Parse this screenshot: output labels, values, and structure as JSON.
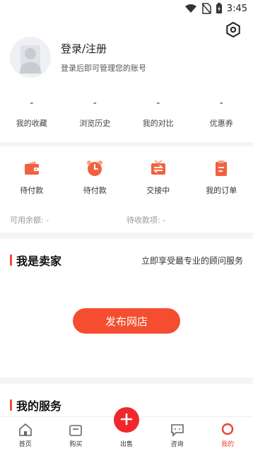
{
  "status": {
    "time": "3:45"
  },
  "profile": {
    "title": "登录/注册",
    "subtitle": "登录后即可管理您的账号",
    "stats": [
      {
        "value": "-",
        "label": "我的收藏"
      },
      {
        "value": "-",
        "label": "浏览历史"
      },
      {
        "value": "-",
        "label": "我的对比"
      },
      {
        "value": "-",
        "label": "优惠券"
      }
    ]
  },
  "orders": {
    "items": [
      {
        "label": "待付款",
        "icon": "wallet-icon"
      },
      {
        "label": "待付款",
        "icon": "alarm-clock-icon"
      },
      {
        "label": "交接中",
        "icon": "exchange-icon"
      },
      {
        "label": "我的订单",
        "icon": "clipboard-icon"
      }
    ],
    "available_balance": "可用余额: -",
    "pending_receivable": "待收款项: -"
  },
  "seller": {
    "title": "我是卖家",
    "subtitle": "立即享受最专业的顾问服务",
    "publish_label": "发布网店"
  },
  "services": {
    "title": "我的服务"
  },
  "tabbar": {
    "tabs": [
      {
        "label": "首页"
      },
      {
        "label": "购买"
      },
      {
        "label": "出售"
      },
      {
        "label": "咨询"
      },
      {
        "label": "我的"
      }
    ]
  },
  "colors": {
    "accent": "#f44d30",
    "active_tab": "#e8432d"
  }
}
